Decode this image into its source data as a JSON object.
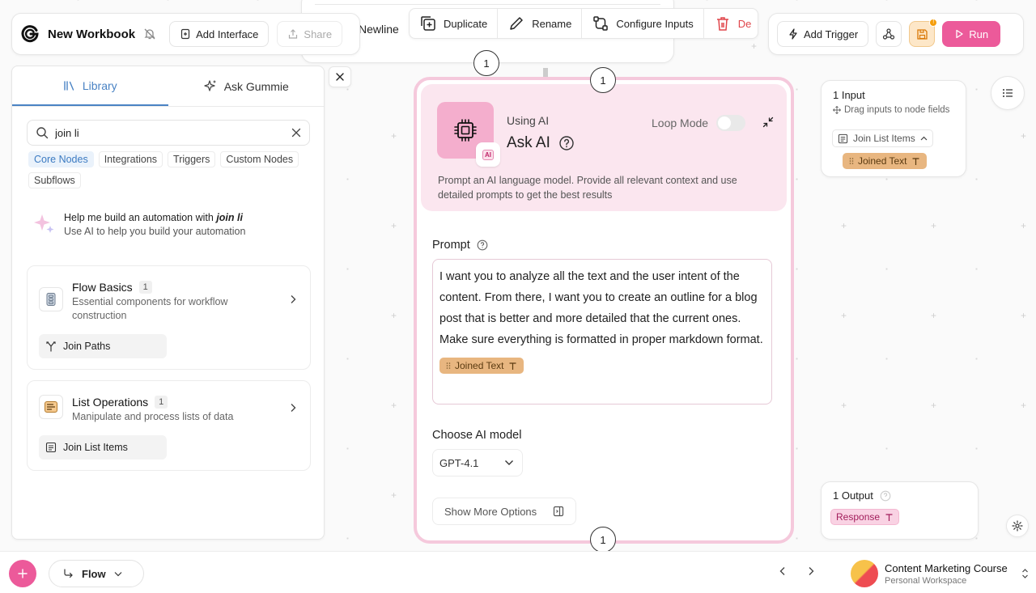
{
  "workbook": {
    "title": "New Workbook",
    "add_interface": "Add Interface",
    "share": "Share"
  },
  "node_toolbar": {
    "newline_label": "Newline",
    "duplicate": "Duplicate",
    "rename": "Rename",
    "configure_inputs": "Configure Inputs",
    "delete": "De"
  },
  "top_right": {
    "add_trigger": "Add Trigger",
    "save_badge": "!",
    "run": "Run"
  },
  "library": {
    "tabs": [
      "Library",
      "Ask Gummie"
    ],
    "search_value": "join li",
    "chips": [
      "Core Nodes",
      "Integrations",
      "Triggers",
      "Custom Nodes",
      "Subflows"
    ],
    "ai_help": {
      "line1_prefix": "Help me build an automation with ",
      "line1_query": "join li",
      "line2": "Use AI to help you build your automation"
    },
    "categories": [
      {
        "title": "Flow Basics",
        "count": "1",
        "description": "Essential components for workflow construction",
        "node": "Join Paths"
      },
      {
        "title": "List Operations",
        "count": "1",
        "description": "Manipulate and process lists of data",
        "node": "Join List Items"
      }
    ]
  },
  "ask_ai": {
    "port_top": "1",
    "port_bottom": "1",
    "port_prev": "1",
    "using": "Using AI",
    "name": "Ask AI",
    "mini_badge": "AI",
    "loop_mode": "Loop Mode",
    "description": "Prompt an AI language model. Provide all relevant context and use detailed prompts to get the best results",
    "prompt_label": "Prompt",
    "prompt_text": "I want you to analyze all the text and the user intent of the content. From there, I want you to create an outline for a blog post that is better and more detailed that the current ones. Make sure everything is formatted in proper markdown format.",
    "prompt_tag": "Joined Text",
    "model_label": "Choose AI model",
    "model_value": "GPT-4.1",
    "more_options": "Show More Options"
  },
  "input_card": {
    "title": "1 Input",
    "hint": "Drag inputs to node fields",
    "source": "Join List Items",
    "tag": "Joined Text"
  },
  "output_card": {
    "title": "1 Output",
    "tag": "Response"
  },
  "bottom": {
    "flow": "Flow",
    "workspace_name": "Content Marketing Course",
    "workspace_sub": "Personal Workspace"
  },
  "colors": {
    "accent_pink": "#ec5a9a",
    "library_blue": "#4a83c4",
    "tag_orange": "#e8b680",
    "card_border": "#f5c9dc"
  }
}
